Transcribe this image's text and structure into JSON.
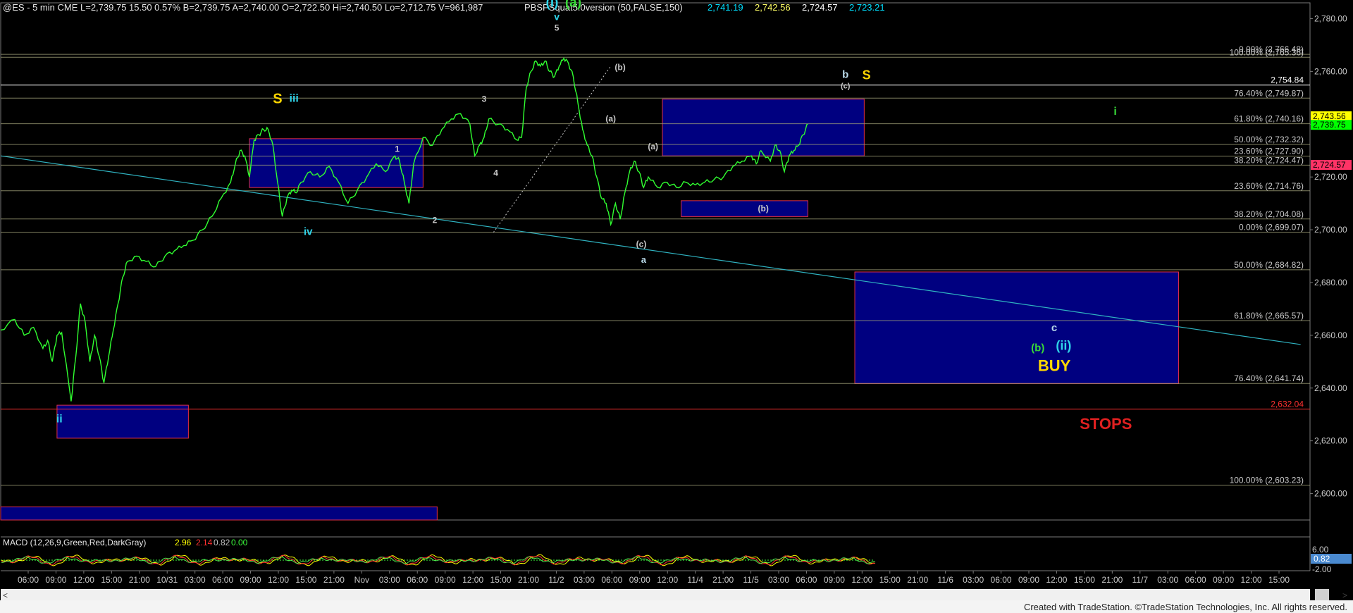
{
  "header": {
    "symbol_info": "@ES - 5 min  CME  L=2,739.75  15.50  0.57%  B=2,739.75  A=2,740.00  O=2,722.50  Hi=2,740.50  Lo=2,712.75  V=961,987",
    "study_name": "PBSPSquat5.0version (50,FALSE,150)",
    "study_values": [
      "2,741.19",
      "2,742.56",
      "2,724.57",
      "2,723.21"
    ],
    "study_colors": [
      "#00e0ff",
      "#ffff66",
      "#ffffff",
      "#00e0ff"
    ]
  },
  "macd": {
    "label": "MACD (12,26,9,Green,Red,DarkGray)",
    "values": [
      "2.96",
      "2.14",
      "0.82",
      "0.00"
    ],
    "value_colors": [
      "#ffff00",
      "#ff3030",
      "#c0c0c0",
      "#3cff3c"
    ],
    "axis_labels": [
      "6.00",
      "0.82",
      "-2.00"
    ]
  },
  "footer": {
    "credit": "Created with TradeStation. ©TradeStation Technologies, Inc. All rights reserved."
  },
  "chart_data": {
    "type": "line",
    "title": "",
    "instrument": "@ES",
    "interval": "5 min",
    "ylim": [
      2590,
      2786
    ],
    "y_ticks": [
      "2,780.00",
      "2,760.00",
      "2,740.00",
      "2,720.00",
      "2,700.00",
      "2,680.00",
      "2,660.00",
      "2,640.00",
      "2,620.00",
      "2,600.00"
    ],
    "y_tick_values": [
      2780,
      2760,
      2740,
      2720,
      2700,
      2680,
      2660,
      2640,
      2620,
      2600
    ],
    "x_tick_labels": [
      "06:00",
      "09:00",
      "12:00",
      "15:00",
      "21:00",
      "10/31",
      "03:00",
      "06:00",
      "09:00",
      "12:00",
      "15:00",
      "21:00",
      "Nov",
      "03:00",
      "06:00",
      "09:00",
      "12:00",
      "15:00",
      "21:00",
      "11/2",
      "03:00",
      "06:00",
      "09:00",
      "12:00",
      "11/4",
      "21:00",
      "11/5",
      "03:00",
      "06:00",
      "09:00",
      "12:00",
      "15:00",
      "21:00",
      "11/6",
      "03:00",
      "06:00",
      "09:00",
      "12:00",
      "15:00",
      "21:00",
      "11/7",
      "03:00",
      "06:00",
      "09:00",
      "12:00",
      "15:00"
    ],
    "series": [
      {
        "name": "",
        "color": "#30ff30",
        "points": [
          [
            0,
            2662
          ],
          [
            3,
            2666
          ],
          [
            5,
            2660
          ],
          [
            7,
            2663
          ],
          [
            9,
            2655
          ],
          [
            10,
            2658
          ],
          [
            11,
            2650
          ],
          [
            12,
            2660
          ],
          [
            13,
            2661
          ],
          [
            15,
            2635
          ],
          [
            16,
            2652
          ],
          [
            17,
            2672
          ],
          [
            18,
            2665
          ],
          [
            19,
            2650
          ],
          [
            20,
            2660
          ],
          [
            21,
            2652
          ],
          [
            22,
            2642
          ],
          [
            23,
            2652
          ],
          [
            24,
            2662
          ],
          [
            25,
            2672
          ],
          [
            26,
            2682
          ],
          [
            27,
            2688
          ],
          [
            29,
            2690
          ],
          [
            31,
            2688
          ],
          [
            33,
            2686
          ],
          [
            35,
            2690
          ],
          [
            37,
            2692
          ],
          [
            39,
            2694
          ],
          [
            41,
            2696
          ],
          [
            43,
            2700
          ],
          [
            45,
            2705
          ],
          [
            47,
            2712
          ],
          [
            49,
            2718
          ],
          [
            50,
            2725
          ],
          [
            51,
            2730
          ],
          [
            52,
            2728
          ],
          [
            53,
            2720
          ],
          [
            54,
            2734
          ],
          [
            55,
            2736
          ],
          [
            56,
            2738
          ],
          [
            57,
            2738
          ],
          [
            58,
            2732
          ],
          [
            59,
            2718
          ],
          [
            60,
            2705
          ],
          [
            61,
            2712
          ],
          [
            62,
            2715
          ],
          [
            63,
            2714
          ],
          [
            64,
            2718
          ],
          [
            66,
            2722
          ],
          [
            68,
            2720
          ],
          [
            70,
            2724
          ],
          [
            72,
            2718
          ],
          [
            74,
            2710
          ],
          [
            76,
            2715
          ],
          [
            78,
            2720
          ],
          [
            80,
            2725
          ],
          [
            82,
            2722
          ],
          [
            84,
            2728
          ],
          [
            85,
            2726
          ],
          [
            86,
            2718
          ],
          [
            87,
            2710
          ],
          [
            88,
            2725
          ],
          [
            90,
            2735
          ],
          [
            92,
            2732
          ],
          [
            94,
            2738
          ],
          [
            96,
            2742
          ],
          [
            98,
            2744
          ],
          [
            100,
            2740
          ],
          [
            101,
            2728
          ],
          [
            102,
            2732
          ],
          [
            103,
            2735
          ],
          [
            104,
            2742
          ],
          [
            106,
            2740
          ],
          [
            108,
            2738
          ],
          [
            110,
            2734
          ],
          [
            111,
            2735
          ],
          [
            112,
            2754
          ],
          [
            113,
            2760
          ],
          [
            114,
            2764
          ],
          [
            115,
            2762
          ],
          [
            116,
            2764
          ],
          [
            117,
            2760
          ],
          [
            118,
            2758
          ],
          [
            119,
            2762
          ],
          [
            120,
            2765
          ],
          [
            121,
            2763
          ],
          [
            122,
            2758
          ],
          [
            123,
            2748
          ],
          [
            124,
            2738
          ],
          [
            125,
            2732
          ],
          [
            126,
            2728
          ],
          [
            127,
            2720
          ],
          [
            128,
            2712
          ],
          [
            129,
            2710
          ],
          [
            130,
            2702
          ],
          [
            131,
            2710
          ],
          [
            132,
            2704
          ],
          [
            133,
            2714
          ],
          [
            134,
            2722
          ],
          [
            135,
            2726
          ],
          [
            136,
            2722
          ],
          [
            137,
            2716
          ],
          [
            138,
            2720
          ],
          [
            140,
            2716
          ],
          [
            142,
            2718
          ],
          [
            144,
            2716
          ],
          [
            146,
            2718
          ],
          [
            148,
            2717
          ],
          [
            150,
            2718
          ],
          [
            152,
            2719
          ],
          [
            154,
            2720
          ],
          [
            156,
            2724
          ],
          [
            158,
            2726
          ],
          [
            160,
            2728
          ],
          [
            161,
            2725
          ],
          [
            162,
            2730
          ],
          [
            164,
            2726
          ],
          [
            165,
            2732
          ],
          [
            166,
            2730
          ],
          [
            167,
            2722
          ],
          [
            168,
            2728
          ],
          [
            169,
            2730
          ],
          [
            170,
            2732
          ],
          [
            171,
            2736
          ],
          [
            172,
            2740
          ]
        ]
      }
    ],
    "fib_levels": [
      {
        "label": "0.00% (2,766.48)",
        "value": 2766.48
      },
      {
        "label": "100.00% (2,765.36)",
        "value": 2765.36
      },
      {
        "label": "76.40% (2,749.87)",
        "value": 2749.87
      },
      {
        "label": "61.80% (2,740.16)",
        "value": 2740.16
      },
      {
        "label": "50.00% (2,732.32)",
        "value": 2732.32
      },
      {
        "label": "23.60% (2,727.90)",
        "value": 2727.9
      },
      {
        "label": "38.20% (2,724.47)",
        "value": 2724.47
      },
      {
        "label": "23.60% (2,714.76)",
        "value": 2714.76
      },
      {
        "label": "38.20% (2,704.08)",
        "value": 2704.08
      },
      {
        "label": "0.00% (2,699.07)",
        "value": 2699.07
      },
      {
        "label": "50.00% (2,684.82)",
        "value": 2684.82
      },
      {
        "label": "61.80% (2,665.57)",
        "value": 2665.57
      },
      {
        "label": "76.40% (2,641.74)",
        "value": 2641.74
      },
      {
        "label": "100.00% (2,603.23)",
        "value": 2603.23
      }
    ],
    "price_lines": [
      {
        "label": "2,754.84",
        "value": 2754.84,
        "color": "#ffffff"
      },
      {
        "label": "2,632.04",
        "value": 2632.04,
        "color": "#ff3030"
      }
    ],
    "price_tags": [
      {
        "label": "2,743.56",
        "value": 2743.0,
        "color": "#ffff00"
      },
      {
        "label": "2,739.75",
        "value": 2739.75,
        "color": "#00ff00"
      },
      {
        "label": "2,724.57",
        "value": 2724.57,
        "color": "#ff3366"
      }
    ],
    "boxes": [
      {
        "x0": 12,
        "x1": 40,
        "y0": 2621,
        "y1": 2633.5
      },
      {
        "x0": 53,
        "x1": 90,
        "y0": 2716,
        "y1": 2734.5
      },
      {
        "x0": 141,
        "x1": 184,
        "y0": 2728,
        "y1": 2749.5
      },
      {
        "x0": 145,
        "x1": 172,
        "y0": 2705,
        "y1": 2711
      },
      {
        "x0": 182,
        "x1": 251,
        "y0": 2641.7,
        "y1": 2684
      },
      {
        "x0": 0,
        "x1": 93,
        "y0": 2590,
        "y1": 2595
      }
    ],
    "trend_line": {
      "x0": 0,
      "y0": 2728,
      "x1": 277,
      "y1": 2656.5,
      "color": "#2fb2c0"
    },
    "dotted_line": {
      "x0": 105,
      "y0": 2699,
      "x1": 130,
      "y1": 2762
    },
    "wave_labels": [
      {
        "text": "(i)",
        "x": 117.5,
        "y": 2784.5,
        "color": "#2fd3e8",
        "size": 19
      },
      {
        "text": "(a)",
        "x": 122,
        "y": 2784.5,
        "color": "#38d838",
        "size": 19
      },
      {
        "text": "v",
        "x": 118.5,
        "y": 2779.5,
        "color": "#2fd3e8",
        "size": 14
      },
      {
        "text": "5",
        "x": 118.5,
        "y": 2775.5,
        "color": "#c8c8c8",
        "size": 12
      },
      {
        "text": "(b)",
        "x": 132,
        "y": 2760.5,
        "color": "#c8c8c8",
        "size": 12
      },
      {
        "text": "(a)",
        "x": 130,
        "y": 2741,
        "color": "#c8c8c8",
        "size": 12
      },
      {
        "text": "(a)",
        "x": 139,
        "y": 2730.5,
        "color": "#c8c8c8",
        "size": 12
      },
      {
        "text": "(c)",
        "x": 136.5,
        "y": 2693.5,
        "color": "#c8c8c8",
        "size": 12
      },
      {
        "text": "a",
        "x": 137,
        "y": 2687.5,
        "color": "#b8d8e8",
        "size": 13
      },
      {
        "text": "b",
        "x": 180,
        "y": 2757.5,
        "color": "#b8d8e8",
        "size": 15
      },
      {
        "text": "(c)",
        "x": 180,
        "y": 2753.5,
        "color": "#c8c8c8",
        "size": 11
      },
      {
        "text": "S",
        "x": 184.5,
        "y": 2757,
        "color": "#ffd700",
        "size": 18
      },
      {
        "text": "S",
        "x": 59,
        "y": 2748,
        "color": "#ffd700",
        "size": 20
      },
      {
        "text": "iii",
        "x": 62.5,
        "y": 2748.5,
        "color": "#2fd3e8",
        "size": 16
      },
      {
        "text": "3",
        "x": 103,
        "y": 2748.5,
        "color": "#c8c8c8",
        "size": 12
      },
      {
        "text": "1",
        "x": 84.5,
        "y": 2729.5,
        "color": "#c8c8c8",
        "size": 12
      },
      {
        "text": "4",
        "x": 105.5,
        "y": 2720.5,
        "color": "#c8c8c8",
        "size": 12
      },
      {
        "text": "2",
        "x": 92.5,
        "y": 2702.5,
        "color": "#c8c8c8",
        "size": 12
      },
      {
        "text": "iv",
        "x": 65.5,
        "y": 2698,
        "color": "#2fd3e8",
        "size": 15
      },
      {
        "text": "(b)",
        "x": 162.5,
        "y": 2707,
        "color": "#c8c8c8",
        "size": 12
      },
      {
        "text": "i",
        "x": 237.5,
        "y": 2743.5,
        "color": "#38d838",
        "size": 16
      },
      {
        "text": "c",
        "x": 224.5,
        "y": 2661.5,
        "color": "#b8d8e8",
        "size": 15
      },
      {
        "text": "(b)",
        "x": 221,
        "y": 2654,
        "color": "#38d838",
        "size": 15
      },
      {
        "text": "(ii)",
        "x": 226.5,
        "y": 2654.5,
        "color": "#2fd3e8",
        "size": 18
      },
      {
        "text": "BUY",
        "x": 224.5,
        "y": 2646.5,
        "color": "#ffd700",
        "size": 22
      },
      {
        "text": "STOPS",
        "x": 235.5,
        "y": 2624.5,
        "color": "#e02020",
        "size": 22
      },
      {
        "text": "ii",
        "x": 12.5,
        "y": 2627,
        "color": "#2fd3e8",
        "size": 16
      }
    ],
    "grid": false,
    "legend": "none"
  }
}
